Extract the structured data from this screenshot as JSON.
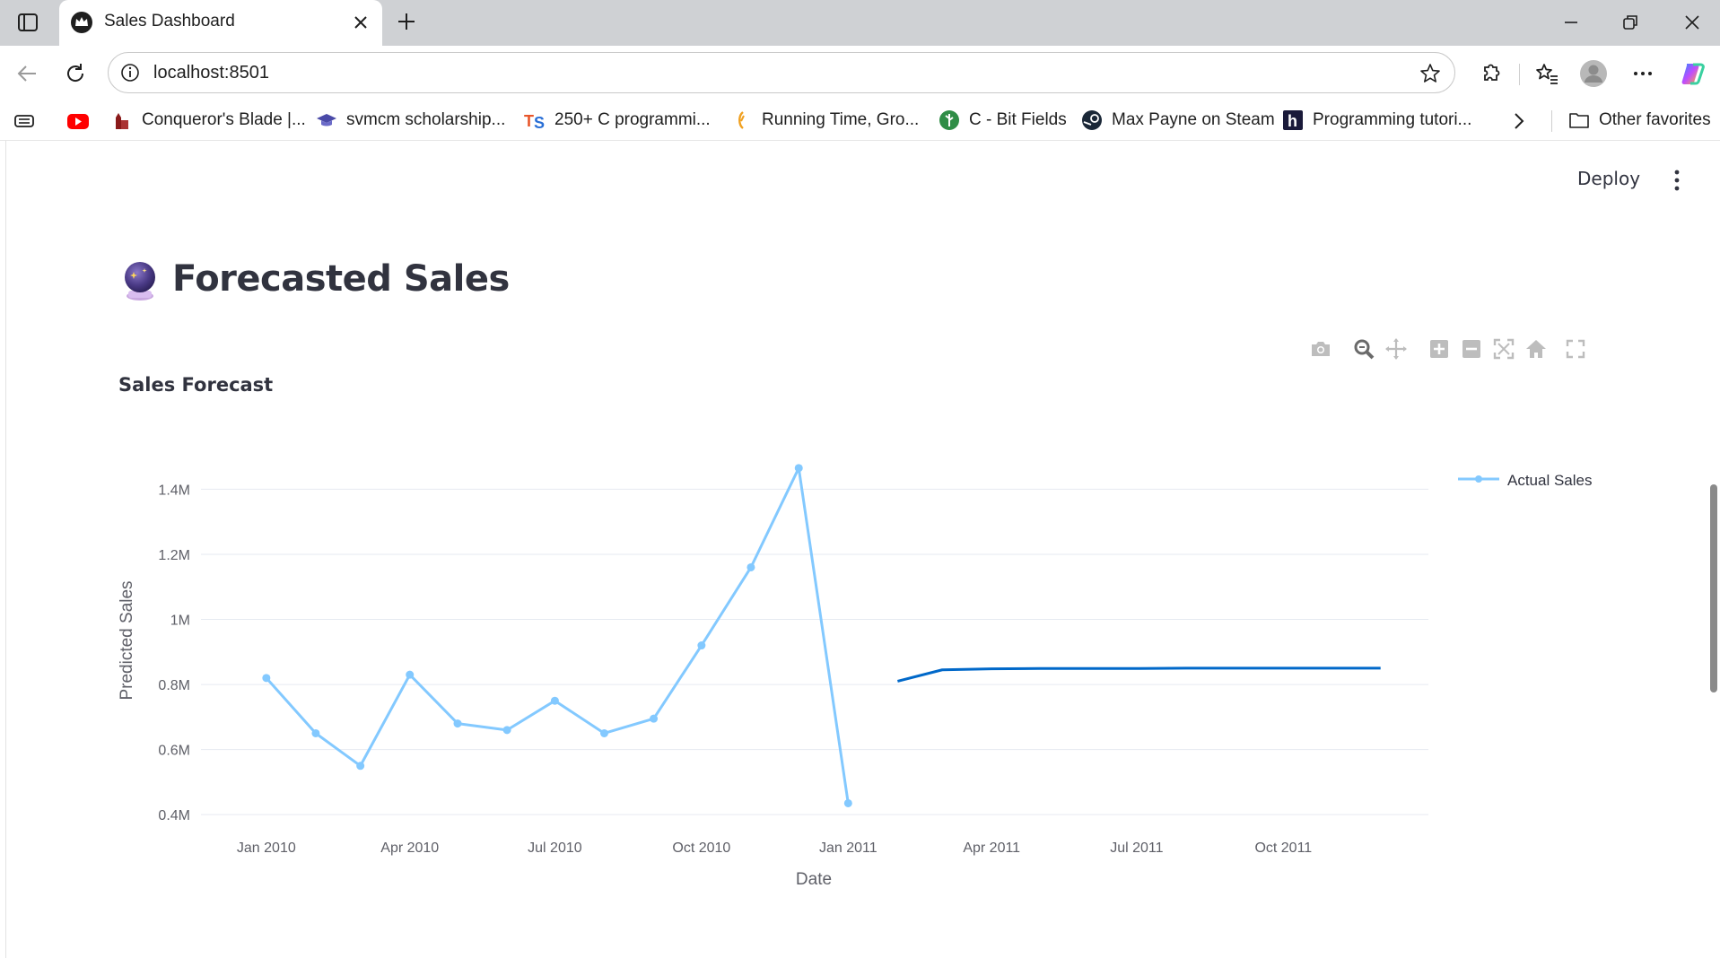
{
  "browser": {
    "tab_title": "Sales Dashboard",
    "address": "localhost:8501",
    "bookmarks": [
      {
        "label": "Conqueror's Blade |...",
        "icon": "castle-icon"
      },
      {
        "label": "svmcm scholarship...",
        "icon": "graduation-cap-icon"
      },
      {
        "label": "250+ C programmi...",
        "icon": "ts-logo-icon"
      },
      {
        "label": "Running Time, Gro...",
        "icon": "bracket-icon"
      },
      {
        "label": "C - Bit Fields",
        "icon": "leaf-icon"
      },
      {
        "label": "Max Payne on Steam",
        "icon": "steam-icon"
      },
      {
        "label": "Programming tutori...",
        "icon": "h-logo-icon"
      }
    ],
    "other_favorites": "Other favorites"
  },
  "app": {
    "deploy_label": "Deploy",
    "page_title": "Forecasted Sales",
    "page_icon": "crystal-ball-icon"
  },
  "chart_data": {
    "type": "line",
    "title": "Sales Forecast",
    "xlabel": "Date",
    "ylabel": "Predicted Sales",
    "x_tick_labels": [
      "Jan 2010",
      "Apr 2010",
      "Jul 2010",
      "Oct 2010",
      "Jan 2011",
      "Apr 2011",
      "Jul 2011",
      "Oct 2011"
    ],
    "y_tick_labels": [
      "0.4M",
      "0.6M",
      "0.8M",
      "1M",
      "1.2M",
      "1.4M"
    ],
    "y_ticks": [
      400000,
      600000,
      800000,
      1000000,
      1200000,
      1400000
    ],
    "ylim": [
      395000,
      1470000
    ],
    "xlim": [
      "2009-11-21",
      "2011-12-31"
    ],
    "grid": true,
    "legend_position": "top-right",
    "series": [
      {
        "name": "Actual Sales",
        "color": "#83c9ff",
        "markers": true,
        "x": [
          "2010-01-01",
          "2010-02-01",
          "2010-03-01",
          "2010-04-01",
          "2010-05-01",
          "2010-06-01",
          "2010-07-01",
          "2010-08-01",
          "2010-09-01",
          "2010-10-01",
          "2010-11-01",
          "2010-12-01",
          "2011-01-01"
        ],
        "values": [
          820000,
          650000,
          550000,
          830000,
          680000,
          660000,
          750000,
          650000,
          695000,
          920000,
          1160000,
          1465000,
          435000
        ]
      },
      {
        "color": "#0068c9",
        "markers": false,
        "x": [
          "2011-02-01",
          "2011-03-01",
          "2011-04-01",
          "2011-05-01",
          "2011-06-01",
          "2011-07-01",
          "2011-08-01",
          "2011-09-01",
          "2011-10-01",
          "2011-11-01",
          "2011-12-01"
        ],
        "values": [
          810000,
          845000,
          848000,
          849000,
          849000,
          849000,
          850000,
          850000,
          850000,
          850000,
          850000
        ]
      }
    ]
  },
  "colors": {
    "actual": "#83c9ff",
    "forecast": "#0068c9",
    "grid": "#e6eaf1",
    "axis_text": "#5f6068"
  }
}
